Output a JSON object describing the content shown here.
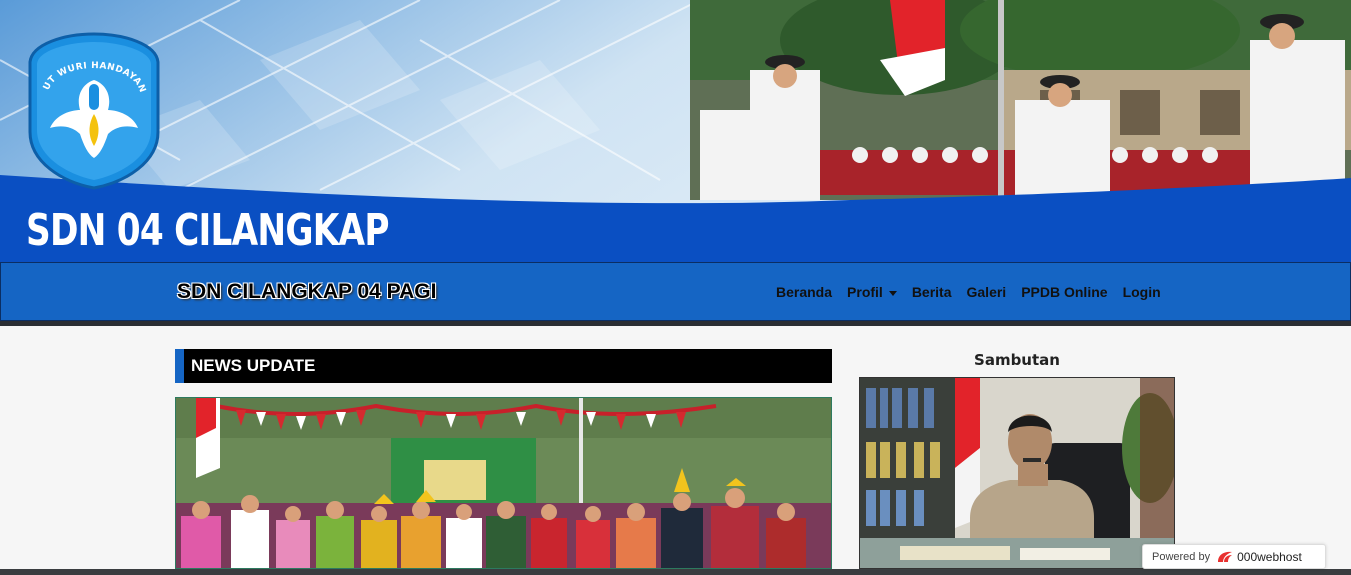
{
  "banner": {
    "school_name": "SDN 04 CILANGKAP",
    "logo_motto": "TUT WURI HANDAYANI"
  },
  "navbar": {
    "brand": "SDN CILANGKAP 04 PAGI",
    "items": [
      {
        "label": "Beranda"
      },
      {
        "label": "Profil"
      },
      {
        "label": "Berita"
      },
      {
        "label": "Galeri"
      },
      {
        "label": "PPDB Online"
      },
      {
        "label": "Login"
      }
    ]
  },
  "main": {
    "news_title": "NEWS UPDATE",
    "sambutan_title": "Sambutan"
  },
  "powered_badge": {
    "prefix": "Powered by",
    "host": "000webhost"
  },
  "colors": {
    "nav_blue": "#1565c4",
    "banner_blue": "#0a4fc2",
    "news_header_bg": "#000000"
  }
}
